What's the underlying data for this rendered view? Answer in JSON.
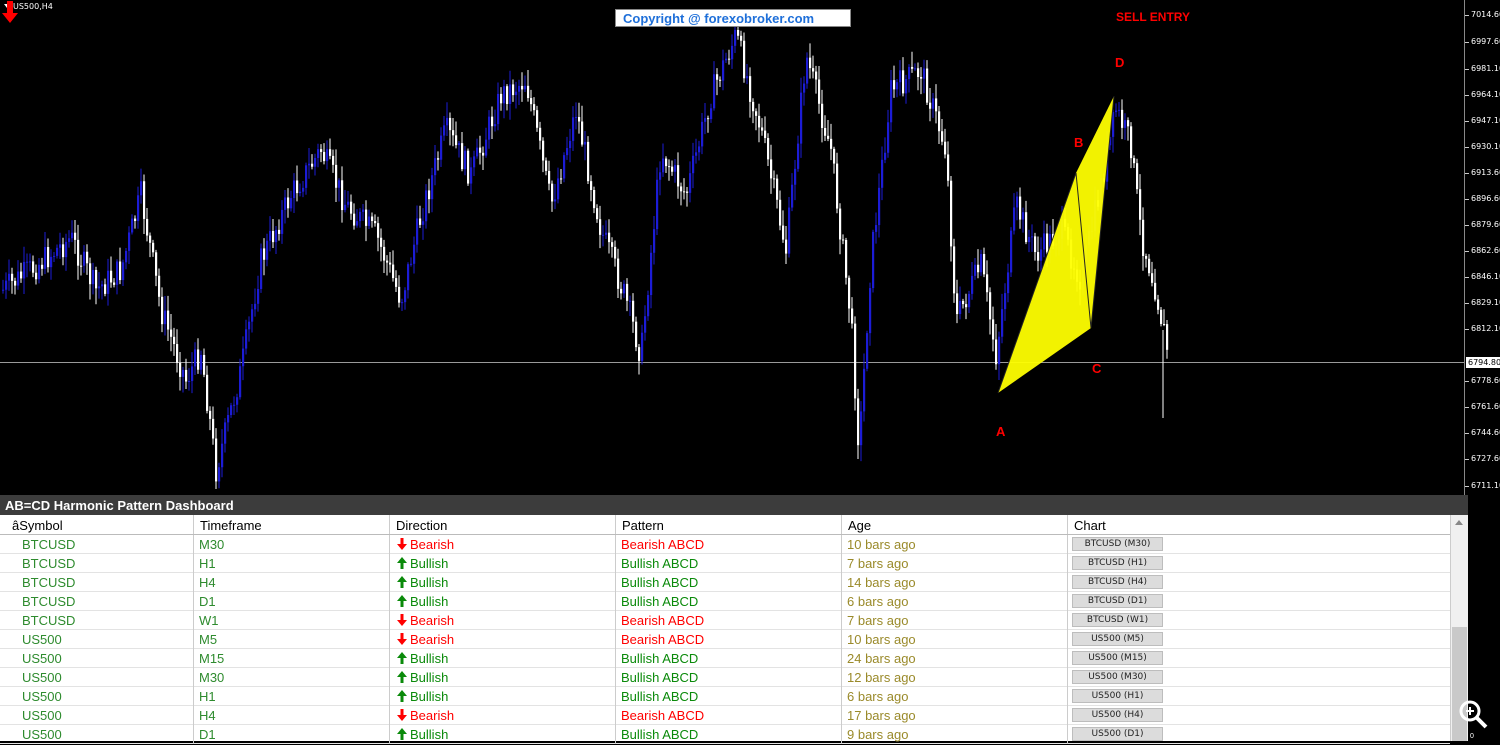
{
  "chart": {
    "symbol_title": "US500,H4",
    "copyright": "Copyright @ forexobroker.com",
    "sell_entry": "SELL ENTRY",
    "points": {
      "a": "A",
      "b": "B",
      "c": "C",
      "d": "D"
    },
    "current_price": "6794.80",
    "y_ticks": [
      "7014.60",
      "6997.60",
      "6981.10",
      "6964.10",
      "6947.10",
      "6930.10",
      "6913.60",
      "6896.60",
      "6879.60",
      "6862.60",
      "6846.10",
      "6829.10",
      "6812.10",
      "6778.60",
      "6761.60",
      "6744.60",
      "6727.60",
      "6711.10"
    ],
    "colors": {
      "bull_candle": "#1c1cd6",
      "bear_candle": "#ffffff",
      "pattern": "#ffff00",
      "label": "#ff0000"
    }
  },
  "dashboard": {
    "title": "AB=CD Harmonic Pattern Dashboard",
    "headers": {
      "symbol": "âSymbol",
      "timeframe": "Timeframe",
      "direction": "Direction",
      "pattern": "Pattern",
      "age": "Age",
      "chart": "Chart"
    },
    "rows": [
      {
        "symbol": "BTCUSD",
        "timeframe": "M30",
        "direction": "Bearish",
        "pattern": "Bearish ABCD",
        "age": "10 bars ago",
        "chart": "BTCUSD (M30)"
      },
      {
        "symbol": "BTCUSD",
        "timeframe": "H1",
        "direction": "Bullish",
        "pattern": "Bullish ABCD",
        "age": "7 bars ago",
        "chart": "BTCUSD (H1)"
      },
      {
        "symbol": "BTCUSD",
        "timeframe": "H4",
        "direction": "Bullish",
        "pattern": "Bullish ABCD",
        "age": "14 bars ago",
        "chart": "BTCUSD (H4)"
      },
      {
        "symbol": "BTCUSD",
        "timeframe": "D1",
        "direction": "Bullish",
        "pattern": "Bullish ABCD",
        "age": "6 bars ago",
        "chart": "BTCUSD (D1)"
      },
      {
        "symbol": "BTCUSD",
        "timeframe": "W1",
        "direction": "Bearish",
        "pattern": "Bearish ABCD",
        "age": "7 bars ago",
        "chart": "BTCUSD (W1)"
      },
      {
        "symbol": "US500",
        "timeframe": "M5",
        "direction": "Bearish",
        "pattern": "Bearish ABCD",
        "age": "10 bars ago",
        "chart": "US500 (M5)"
      },
      {
        "symbol": "US500",
        "timeframe": "M15",
        "direction": "Bullish",
        "pattern": "Bullish ABCD",
        "age": "24 bars ago",
        "chart": "US500 (M15)"
      },
      {
        "symbol": "US500",
        "timeframe": "M30",
        "direction": "Bullish",
        "pattern": "Bullish ABCD",
        "age": "12 bars ago",
        "chart": "US500 (M30)"
      },
      {
        "symbol": "US500",
        "timeframe": "H1",
        "direction": "Bullish",
        "pattern": "Bullish ABCD",
        "age": "6 bars ago",
        "chart": "US500 (H1)"
      },
      {
        "symbol": "US500",
        "timeframe": "H4",
        "direction": "Bearish",
        "pattern": "Bearish ABCD",
        "age": "17 bars ago",
        "chart": "US500 (H4)"
      },
      {
        "symbol": "US500",
        "timeframe": "D1",
        "direction": "Bullish",
        "pattern": "Bullish ABCD",
        "age": "9 bars ago",
        "chart": "US500 (D1)"
      }
    ],
    "scroll_zero": "0"
  }
}
